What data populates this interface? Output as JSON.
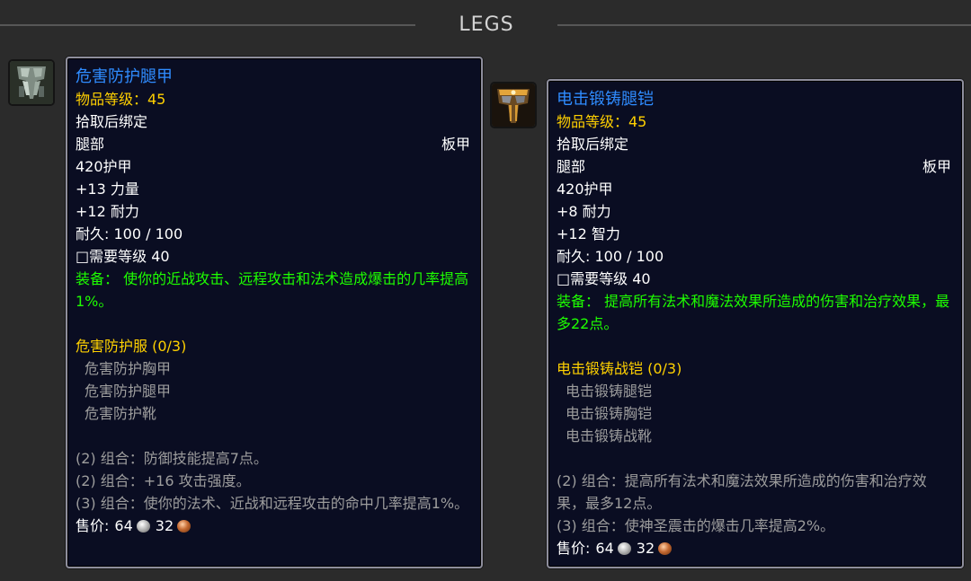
{
  "header": {
    "title": "LEGS"
  },
  "items": [
    {
      "icon": "plate-leg-armor-icon",
      "name": "危害防护腿甲",
      "item_level": "物品等级：45",
      "bind": "拾取后绑定",
      "slot": "腿部",
      "armor_type": "板甲",
      "armor": "420护甲",
      "stats": [
        "+13 力量",
        "+12 耐力"
      ],
      "durability": "耐久: 100 / 100",
      "required_level": "□需要等级 40",
      "equip": "装备： 使你的近战攻击、远程攻击和法术造成爆击的几率提高1%。",
      "set_name": "危害防护服 (0/3)",
      "set_pieces": [
        "危害防护胸甲",
        "危害防护腿甲",
        "危害防护靴"
      ],
      "set_bonuses": [
        "(2) 组合：防御技能提高7点。",
        "(2) 组合：+16 攻击强度。",
        "(3) 组合：使你的法术、近战和远程攻击的命中几率提高1%。"
      ],
      "sell_label": "售价:",
      "sell_silver": "64",
      "sell_copper": "32"
    },
    {
      "icon": "ornate-leg-armor-icon",
      "name": "电击锻铸腿铠",
      "item_level": "物品等级：45",
      "bind": "拾取后绑定",
      "slot": "腿部",
      "armor_type": "板甲",
      "armor": "420护甲",
      "stats": [
        "+8 耐力",
        "+12 智力"
      ],
      "durability": "耐久: 100 / 100",
      "required_level": "□需要等级 40",
      "equip": "装备： 提高所有法术和魔法效果所造成的伤害和治疗效果，最多22点。",
      "set_name": "电击锻铸战铠 (0/3)",
      "set_pieces": [
        "电击锻铸腿铠",
        "电击锻铸胸铠",
        "电击锻铸战靴"
      ],
      "set_bonuses": [
        "(2) 组合：提高所有法术和魔法效果所造成的伤害和治疗效果，最多12点。",
        "(3) 组合：使神圣震击的爆击几率提高2%。"
      ],
      "sell_label": "售价:",
      "sell_silver": "64",
      "sell_copper": "32"
    }
  ]
}
